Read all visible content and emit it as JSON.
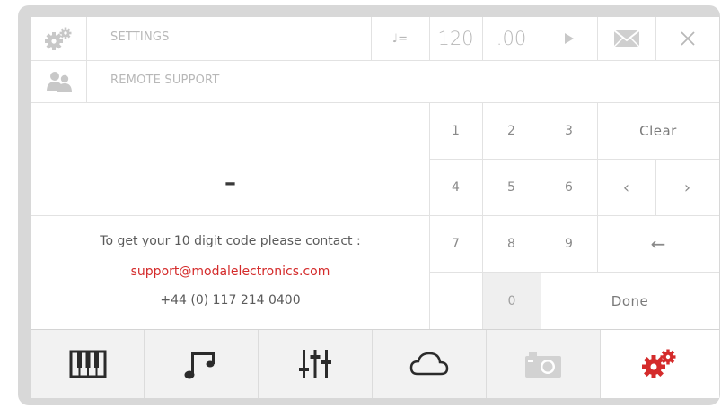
{
  "header": {
    "settings_label": "SETTINGS",
    "remote_label": "REMOTE SUPPORT",
    "tempo_symbol": "♩=",
    "tempo_value": "120",
    "tempo_decimal": ".00"
  },
  "code_display": {
    "value": "–"
  },
  "message": {
    "line1": "To get your 10 digit code please contact :",
    "email": "support@modalelectronics.com",
    "phone": "+44 (0) 117 214 0400"
  },
  "keypad": {
    "k1": "1",
    "k2": "2",
    "k3": "3",
    "k4": "4",
    "k5": "5",
    "k6": "6",
    "k7": "7",
    "k8": "8",
    "k9": "9",
    "k0": "0",
    "clear": "Clear",
    "left": "‹",
    "right": "›",
    "backspace": "←",
    "done": "Done"
  },
  "colors": {
    "accent_red": "#d42b2b",
    "icon_dark": "#2b2b2b",
    "icon_light": "#c8c8c8",
    "active_key_bg": "#efefef"
  },
  "nav": {
    "active_item": "settings-gears-icon"
  }
}
